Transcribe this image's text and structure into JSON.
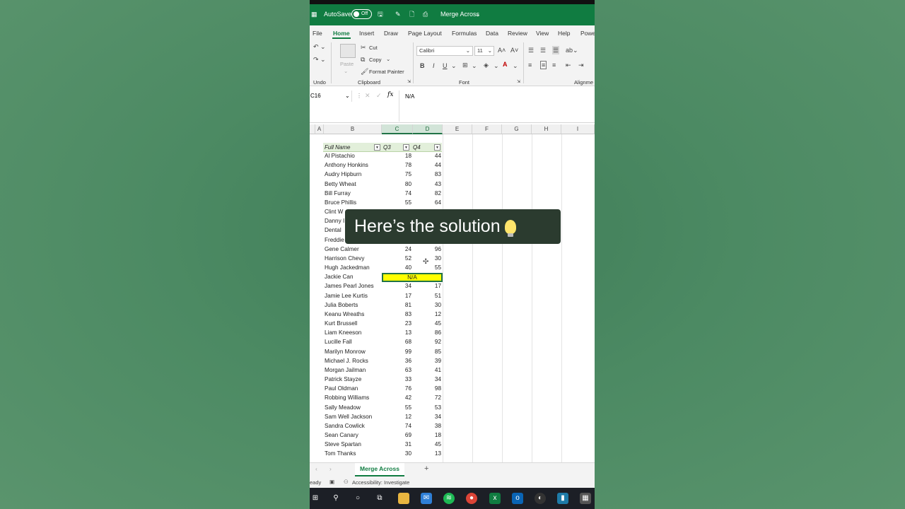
{
  "titlebar": {
    "autosave": "AutoSave",
    "toggle": "Off",
    "document_title": "Merge Across"
  },
  "menu": [
    "File",
    "Home",
    "Insert",
    "Draw",
    "Page Layout",
    "Formulas",
    "Data",
    "Review",
    "View",
    "Help",
    "Powe"
  ],
  "ribbon": {
    "cut": "Cut",
    "copy": "Copy",
    "format_painter": "Format Painter",
    "paste": "Paste",
    "font_name": "Calibri",
    "font_size": "11",
    "groups": {
      "undo": "Undo",
      "clipboard": "Clipboard",
      "font": "Font",
      "alignment": "Alignme"
    }
  },
  "formula": {
    "name_box": "C16",
    "fx": "fx",
    "content": "N/A"
  },
  "columns": [
    "A",
    "B",
    "C",
    "D",
    "E",
    "F",
    "G",
    "H",
    "I"
  ],
  "table": {
    "headers": {
      "name": "Full Name",
      "q3": "Q3",
      "q4": "Q4"
    },
    "rows": [
      {
        "name": "Al Pistachio",
        "q3": "18",
        "q4": "44"
      },
      {
        "name": "Anthony Honkins",
        "q3": "78",
        "q4": "44"
      },
      {
        "name": "Audry Hipburn",
        "q3": "75",
        "q4": "83"
      },
      {
        "name": "Betty Wheat",
        "q3": "80",
        "q4": "43"
      },
      {
        "name": "Bill Furray",
        "q3": "74",
        "q4": "82"
      },
      {
        "name": "Bruce Phillis",
        "q3": "55",
        "q4": "64"
      },
      {
        "name": "Clint W",
        "q3": "",
        "q4": ""
      },
      {
        "name": "Danny I",
        "q3": "",
        "q4": ""
      },
      {
        "name": "Dental",
        "q3": "",
        "q4": ""
      },
      {
        "name": "Freddie",
        "q3": "",
        "q4": ""
      },
      {
        "name": "Gene Calmer",
        "q3": "24",
        "q4": "96"
      },
      {
        "name": "Harrison Chevy",
        "q3": "52",
        "q4": "30"
      },
      {
        "name": "Hugh Jackedman",
        "q3": "40",
        "q4": "55"
      },
      {
        "name": "Jackie Can",
        "merged": "N/A"
      },
      {
        "name": "James Pearl Jones",
        "q3": "34",
        "q4": "17"
      },
      {
        "name": "Jamie Lee Kurtis",
        "q3": "17",
        "q4": "51"
      },
      {
        "name": "Julia Boberts",
        "q3": "81",
        "q4": "30"
      },
      {
        "name": "Keanu Wreaths",
        "q3": "83",
        "q4": "12"
      },
      {
        "name": "Kurt Brussell",
        "q3": "23",
        "q4": "45"
      },
      {
        "name": "Liam Kneeson",
        "q3": "13",
        "q4": "86"
      },
      {
        "name": "Lucille Fall",
        "q3": "68",
        "q4": "92"
      },
      {
        "name": "Marilyn Monrow",
        "q3": "99",
        "q4": "85"
      },
      {
        "name": "Michael J. Rocks",
        "q3": "36",
        "q4": "39"
      },
      {
        "name": "Morgan Jailman",
        "q3": "63",
        "q4": "41"
      },
      {
        "name": "Patrick Stayze",
        "q3": "33",
        "q4": "34"
      },
      {
        "name": "Paul Oldman",
        "q3": "76",
        "q4": "98"
      },
      {
        "name": "Robbing Williams",
        "q3": "42",
        "q4": "72"
      },
      {
        "name": "Sally Meadow",
        "q3": "55",
        "q4": "53"
      },
      {
        "name": "Sam Well Jackson",
        "q3": "12",
        "q4": "34"
      },
      {
        "name": "Sandra Cowlick",
        "q3": "74",
        "q4": "38"
      },
      {
        "name": "Sean Canary",
        "q3": "69",
        "q4": "18"
      },
      {
        "name": "Steve Spartan",
        "q3": "31",
        "q4": "45"
      },
      {
        "name": "Tom Thanks",
        "q3": "30",
        "q4": "13"
      }
    ]
  },
  "sheet_tab": "Merge Across",
  "status": {
    "ready": "eady",
    "accessibility": "Accessibility: Investigate"
  },
  "overlay_text": "Here’s the solution",
  "colors": {
    "excel_green": "#107c41",
    "highlight": "#ffff00",
    "header_fill": "#e2efda"
  }
}
